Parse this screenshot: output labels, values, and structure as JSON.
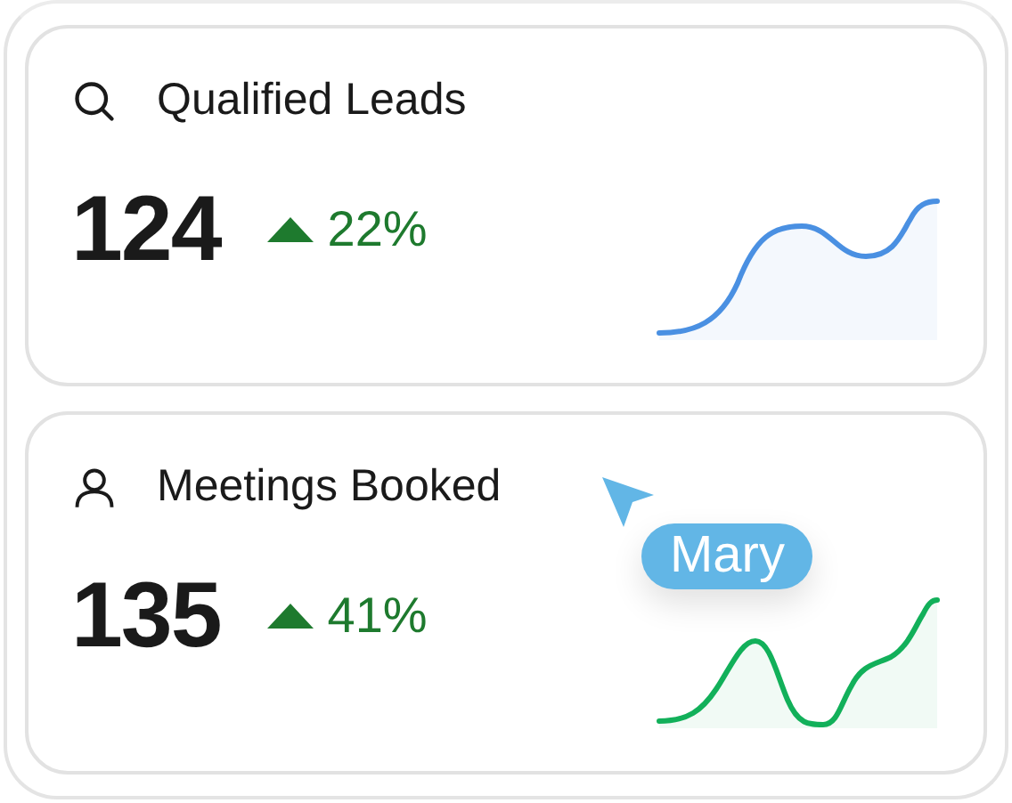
{
  "cards": [
    {
      "kind": "search",
      "title": "Qualified Leads",
      "value": "124",
      "change": "22%",
      "color": "#4a90e2"
    },
    {
      "kind": "person",
      "title": "Meetings Booked",
      "value": "135",
      "change": "41%",
      "color": "#12b05a"
    }
  ],
  "cursor": {
    "label": "Mary"
  }
}
